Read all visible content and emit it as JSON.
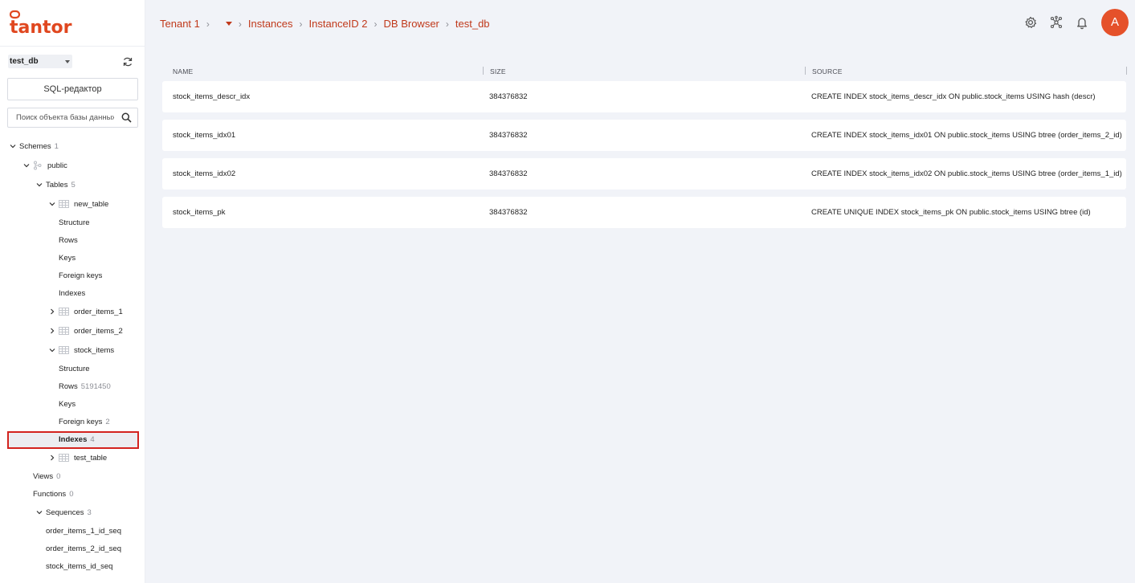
{
  "brand": {
    "name": "tantor",
    "color": "#e0471f"
  },
  "sidebar": {
    "database": "test_db",
    "sql_editor_label": "SQL-редактор",
    "search_placeholder": "Поиск объекта базы данных",
    "tree": {
      "schemes": {
        "label": "Schemes",
        "count": "1"
      },
      "public": {
        "label": "public"
      },
      "tables": {
        "label": "Tables",
        "count": "5"
      },
      "new_table": {
        "label": "new_table"
      },
      "new_table_children": [
        "Structure",
        "Rows",
        "Keys",
        "Foreign keys",
        "Indexes"
      ],
      "order_items_1": {
        "label": "order_items_1"
      },
      "order_items_2": {
        "label": "order_items_2"
      },
      "stock_items": {
        "label": "stock_items"
      },
      "stock_structure": {
        "label": "Structure"
      },
      "stock_rows": {
        "label": "Rows",
        "count": "5191450"
      },
      "stock_keys": {
        "label": "Keys"
      },
      "stock_fkeys": {
        "label": "Foreign keys",
        "count": "2"
      },
      "stock_indexes": {
        "label": "Indexes",
        "count": "4"
      },
      "test_table": {
        "label": "test_table"
      },
      "views": {
        "label": "Views",
        "count": "0"
      },
      "functions": {
        "label": "Functions",
        "count": "0"
      },
      "sequences": {
        "label": "Sequences",
        "count": "3"
      },
      "sequence_items": [
        "order_items_1_id_seq",
        "order_items_2_id_seq",
        "stock_items_id_seq"
      ]
    }
  },
  "header": {
    "breadcrumbs": [
      "Tenant 1",
      "Instances",
      "InstanceID 2",
      "DB Browser",
      "test_db"
    ],
    "avatar_letter": "A"
  },
  "table": {
    "columns": [
      "NAME",
      "SIZE",
      "SOURCE"
    ],
    "rows": [
      {
        "name": "stock_items_descr_idx",
        "size": "384376832",
        "source": "CREATE INDEX stock_items_descr_idx ON public.stock_items USING hash (descr)"
      },
      {
        "name": "stock_items_idx01",
        "size": "384376832",
        "source": "CREATE INDEX stock_items_idx01 ON public.stock_items USING btree (order_items_2_id)"
      },
      {
        "name": "stock_items_idx02",
        "size": "384376832",
        "source": "CREATE INDEX stock_items_idx02 ON public.stock_items USING btree (order_items_1_id)"
      },
      {
        "name": "stock_items_pk",
        "size": "384376832",
        "source": "CREATE UNIQUE INDEX stock_items_pk ON public.stock_items USING btree (id)"
      }
    ]
  }
}
